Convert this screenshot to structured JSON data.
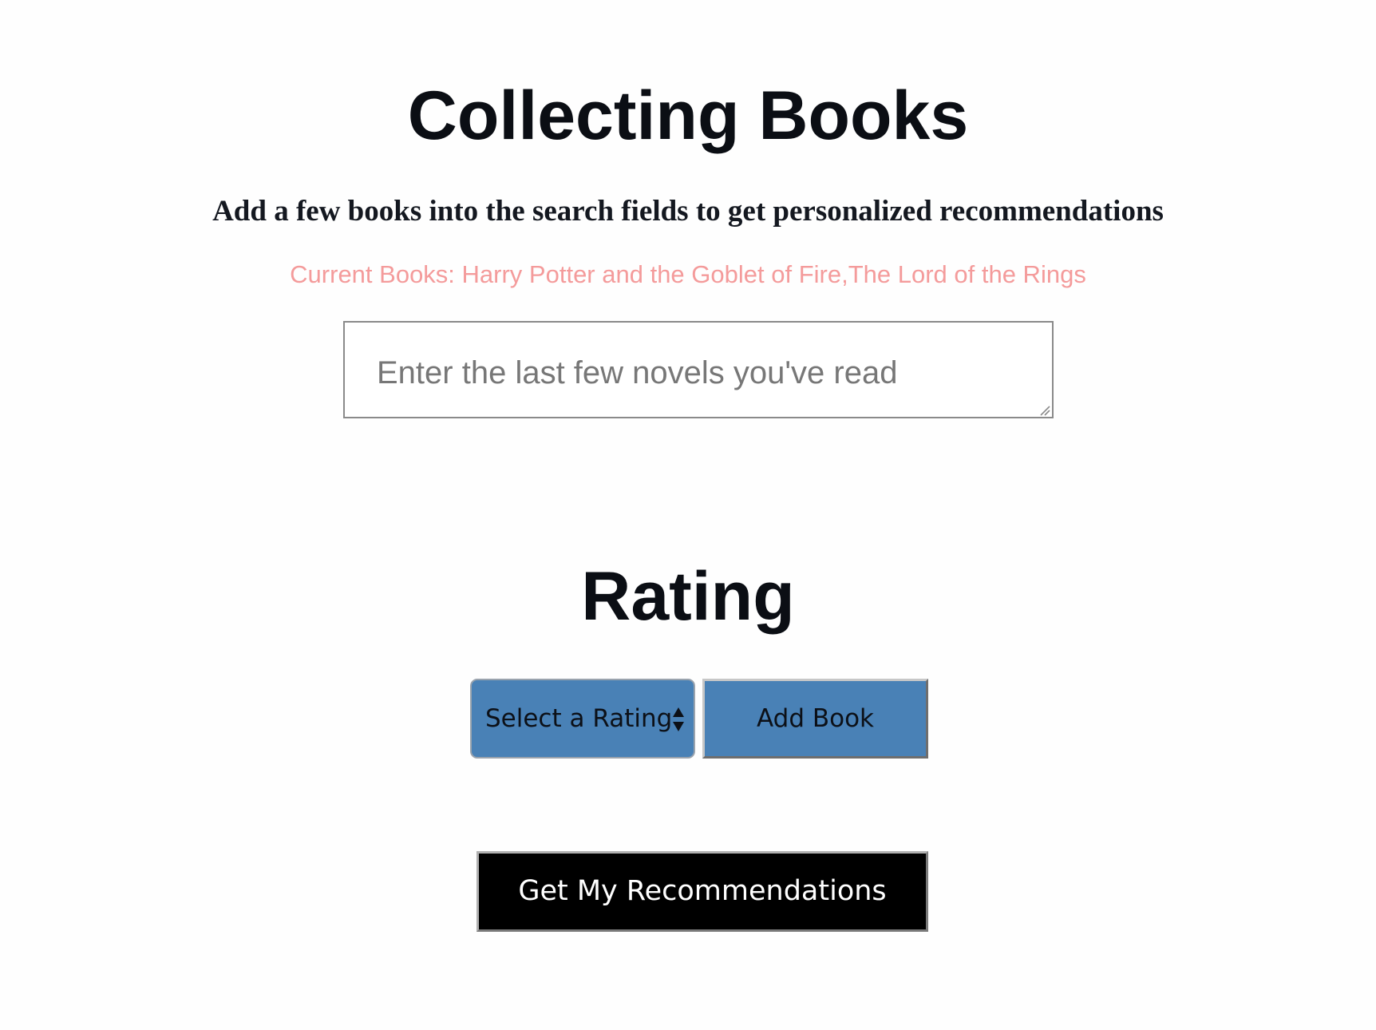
{
  "header": {
    "title": "Collecting Books",
    "subtitle": "Add a few books into the search fields to get personalized recommendations"
  },
  "current_books": {
    "text": "Current Books: Harry Potter and the Goblet of Fire,The Lord of the Rings",
    "color": "#f49b9b"
  },
  "novels_input": {
    "value": "",
    "placeholder": "Enter the last few novels you've read"
  },
  "rating": {
    "heading": "Rating",
    "select_selected": "Select a Rating",
    "add_book_label": "Add Book",
    "accent_color": "#4981b6"
  },
  "recommend": {
    "label": "Get My Recommendations"
  },
  "icons": {
    "select_arrows": "chevron-up-down-icon",
    "resize_grip": "resize-grip-icon"
  }
}
